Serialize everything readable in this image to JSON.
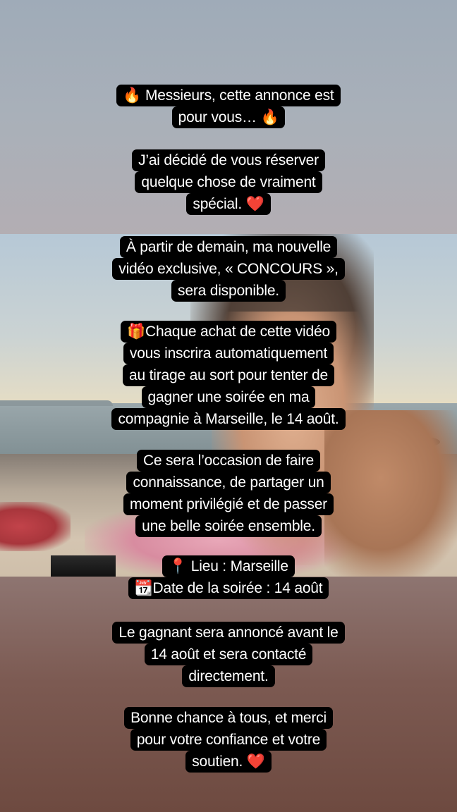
{
  "story": {
    "paragraphs": [
      {
        "lines": [
          "🔥 Messieurs, cette annonce est",
          "pour vous… 🔥"
        ]
      },
      {
        "lines": [
          "J’ai décidé de vous réserver",
          "quelque chose de vraiment",
          "spécial. ❤️"
        ]
      },
      {
        "lines": [
          "À partir de demain, ma nouvelle",
          "vidéo exclusive, « CONCOURS »,",
          "sera disponible."
        ]
      },
      {
        "lines": [
          "🎁Chaque achat de cette vidéo",
          "vous inscrira automatiquement",
          "au tirage au sort pour tenter de",
          "gagner une soirée en ma",
          "compagnie à Marseille, le 14 août."
        ]
      },
      {
        "lines": [
          "Ce sera l’occasion de faire",
          "connaissance, de partager un",
          "moment privilégié et de passer",
          "une belle soirée ensemble."
        ]
      },
      {
        "lines": [
          "📍 Lieu : Marseille",
          "📆Date de la soirée : 14 août"
        ]
      },
      {
        "lines": [
          "Le gagnant sera annoncé avant le",
          "14 août et sera contacté",
          "directement."
        ]
      },
      {
        "lines": [
          "Bonne chance à tous, et merci",
          "pour votre confiance et votre",
          "soutien. ❤️"
        ]
      }
    ]
  },
  "colors": {
    "caption_background": "#000000",
    "caption_text": "#ffffff",
    "top_background": "#a9b0b9",
    "bottom_background": "#7c5a52"
  }
}
